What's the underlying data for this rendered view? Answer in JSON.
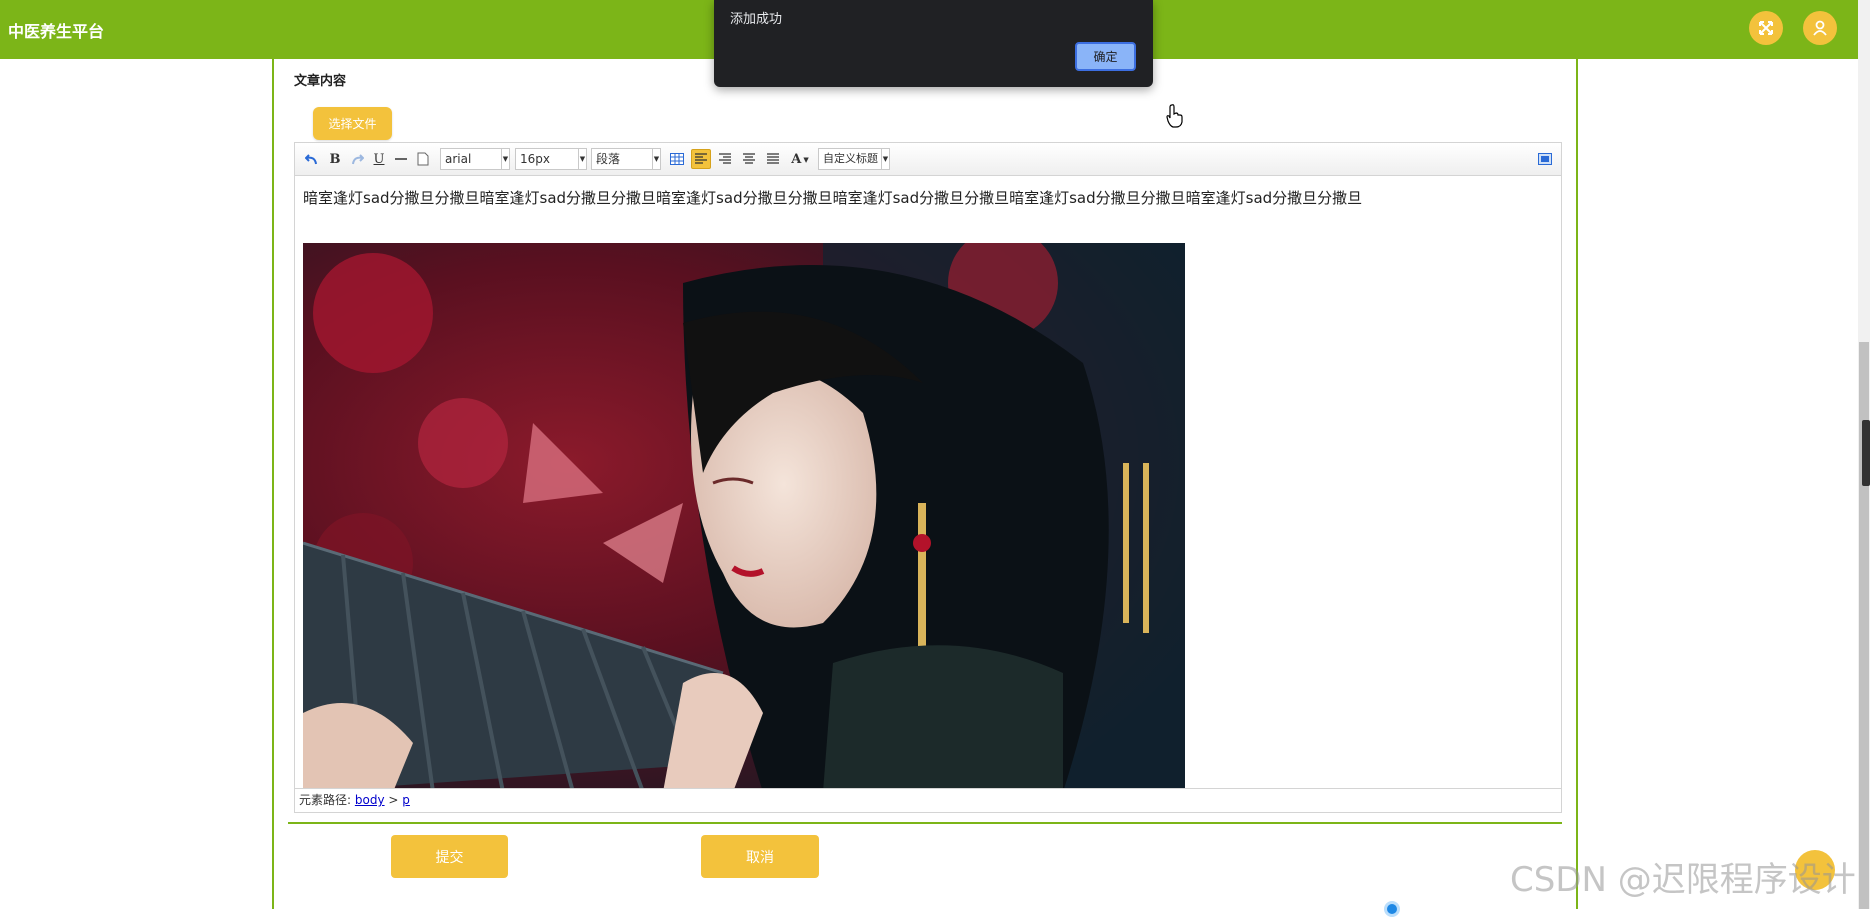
{
  "app": {
    "title": "中医养生平台"
  },
  "header": {
    "expand_icon": "expand-arrows-icon",
    "user_icon": "user-icon"
  },
  "form": {
    "field_label": "文章内容",
    "file_button": "选择文件",
    "submit_label": "提交",
    "cancel_label": "取消"
  },
  "editor": {
    "font_family": "arial",
    "font_size": "16px",
    "paragraph": "段落",
    "custom_title": "自定义标题",
    "content_text": "暗室逢灯sad分撒旦分撒旦暗室逢灯sad分撒旦分撒旦暗室逢灯sad分撒旦分撒旦暗室逢灯sad分撒旦分撒旦暗室逢灯sad分撒旦分撒旦暗室逢灯sad分撒旦分撒旦",
    "image_desc": "illustration-woman-with-fan",
    "path_label": "元素路径:",
    "path_body": "body",
    "path_sep": ">",
    "path_p": "p"
  },
  "alert": {
    "message": "添加成功",
    "ok_label": "确定"
  },
  "watermark": "CSDN @迟限程序设计",
  "colors": {
    "brand_green": "#7cb518",
    "accent_yellow": "#f3c23c",
    "dialog_bg": "#202124",
    "dialog_button": "#8ab4f8"
  }
}
